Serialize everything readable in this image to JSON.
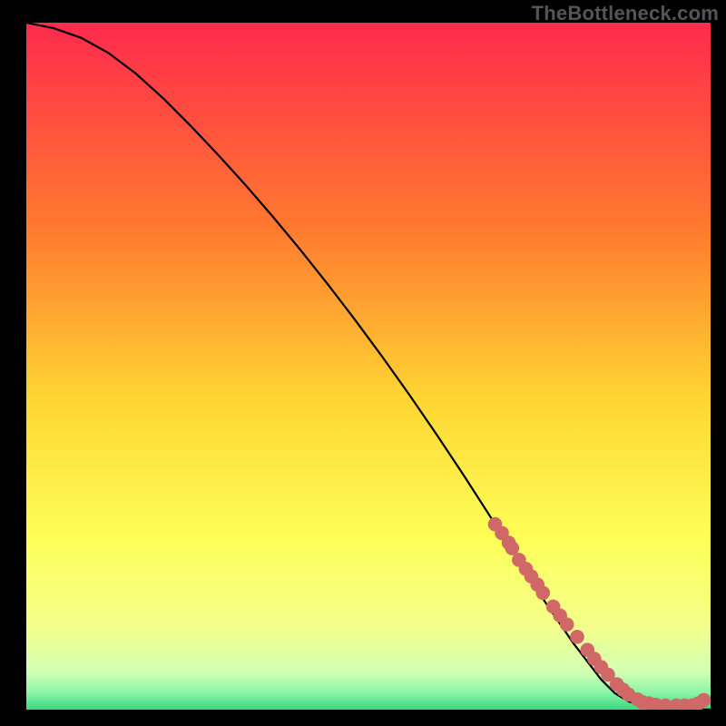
{
  "attribution": "TheBottleneck.com",
  "colors": {
    "curve": "#000000",
    "dots": "#d16868",
    "gradient_top": "#ff2a4d",
    "gradient_mid_upper": "#ff9a2a",
    "gradient_mid": "#ffe335",
    "gradient_mid_lower": "#f6ff6b",
    "gradient_low": "#dfffb0",
    "gradient_bottom": "#4fe08a"
  },
  "chart_data": {
    "type": "line",
    "title": "",
    "xlabel": "",
    "ylabel": "",
    "xlim": [
      0,
      100
    ],
    "ylim": [
      0,
      100
    ],
    "gradient_stops": [
      {
        "offset": 0.0,
        "color": "#ff2a4d"
      },
      {
        "offset": 0.3,
        "color": "#ff7a2f"
      },
      {
        "offset": 0.55,
        "color": "#ffd633"
      },
      {
        "offset": 0.75,
        "color": "#feff58"
      },
      {
        "offset": 0.88,
        "color": "#f3ff8c"
      },
      {
        "offset": 0.945,
        "color": "#d2ffb3"
      },
      {
        "offset": 0.975,
        "color": "#8cf5a7"
      },
      {
        "offset": 1.0,
        "color": "#39d77f"
      }
    ],
    "series": [
      {
        "name": "curve",
        "kind": "line",
        "x": [
          0,
          4,
          8,
          12,
          16,
          20,
          24,
          28,
          32,
          36,
          40,
          44,
          48,
          52,
          56,
          60,
          64,
          68,
          72,
          76,
          80,
          84,
          86,
          88,
          90,
          92,
          94,
          96,
          98,
          100
        ],
        "y": [
          100,
          99.2,
          97.8,
          95.6,
          92.6,
          89.0,
          85.0,
          80.8,
          76.4,
          71.8,
          67.0,
          62.0,
          56.8,
          51.4,
          45.8,
          40.0,
          34.0,
          27.8,
          21.6,
          15.4,
          9.6,
          4.4,
          2.4,
          1.2,
          0.6,
          0.3,
          0.15,
          0.08,
          0.04,
          0.02
        ]
      },
      {
        "name": "dots",
        "kind": "scatter",
        "x": [
          68.5,
          69.5,
          70.5,
          71.0,
          72.0,
          73.0,
          73.8,
          74.7,
          75.5,
          77.0,
          78.0,
          79.0,
          80.5,
          82.0,
          83.0,
          84.0,
          85.0,
          86.3,
          87.2,
          88.0,
          89.3,
          90.0,
          91.0,
          92.0,
          93.4,
          95.0,
          96.2,
          97.3,
          98.2,
          99.0
        ],
        "y": [
          27.0,
          25.7,
          24.3,
          23.5,
          21.8,
          20.5,
          19.4,
          18.2,
          17.0,
          15.0,
          13.7,
          12.4,
          10.6,
          8.7,
          7.4,
          6.2,
          5.1,
          3.7,
          2.9,
          2.2,
          1.5,
          1.1,
          0.9,
          0.7,
          0.6,
          0.6,
          0.6,
          0.6,
          0.9,
          1.4
        ]
      }
    ]
  }
}
